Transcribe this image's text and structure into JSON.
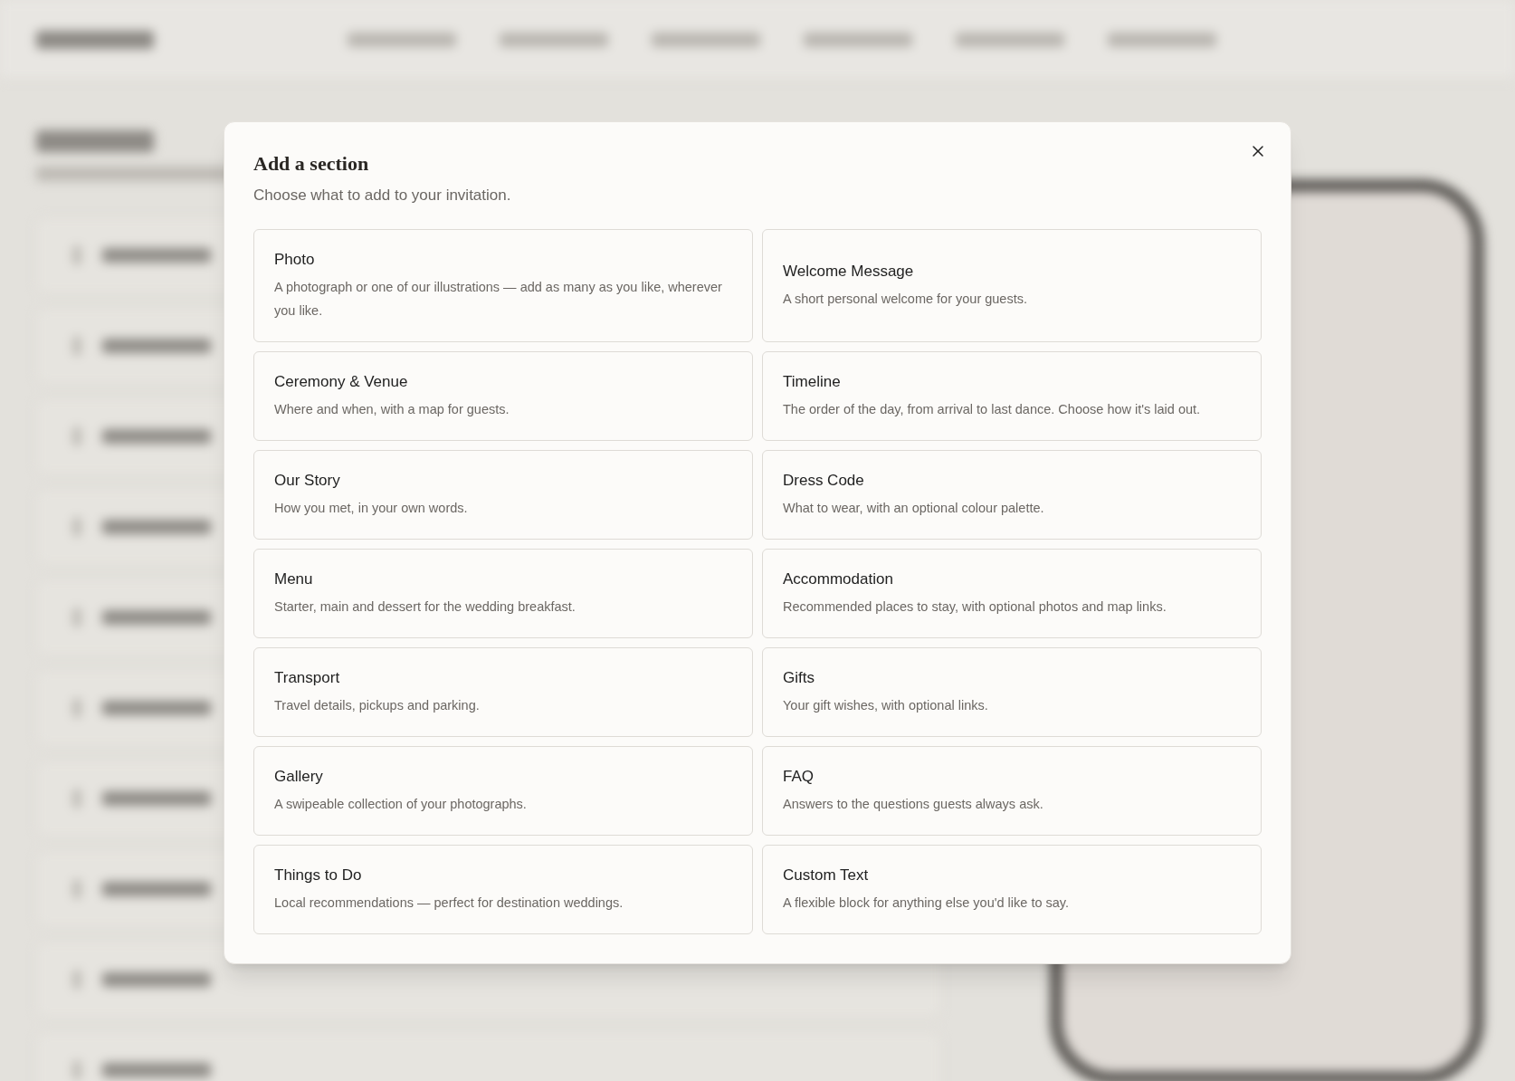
{
  "dialog": {
    "title": "Add a section",
    "subtitle": "Choose what to add to your invitation.",
    "options": [
      {
        "title": "Photo",
        "description": "A photograph or one of our illustrations — add as many as you like, wherever you like."
      },
      {
        "title": "Welcome Message",
        "description": "A short personal welcome for your guests."
      },
      {
        "title": "Ceremony & Venue",
        "description": "Where and when, with a map for guests."
      },
      {
        "title": "Timeline",
        "description": "The order of the day, from arrival to last dance. Choose how it's laid out."
      },
      {
        "title": "Our Story",
        "description": "How you met, in your own words."
      },
      {
        "title": "Dress Code",
        "description": "What to wear, with an optional colour palette."
      },
      {
        "title": "Menu",
        "description": "Starter, main and dessert for the wedding breakfast."
      },
      {
        "title": "Accommodation",
        "description": "Recommended places to stay, with optional photos and map links."
      },
      {
        "title": "Transport",
        "description": "Travel details, pickups and parking."
      },
      {
        "title": "Gifts",
        "description": "Your gift wishes, with optional links."
      },
      {
        "title": "Gallery",
        "description": "A swipeable collection of your photographs."
      },
      {
        "title": "FAQ",
        "description": "Answers to the questions guests always ask."
      },
      {
        "title": "Things to Do",
        "description": "Local recommendations — perfect for destination weddings."
      },
      {
        "title": "Custom Text",
        "description": "A flexible block for anything else you'd like to say."
      }
    ]
  }
}
